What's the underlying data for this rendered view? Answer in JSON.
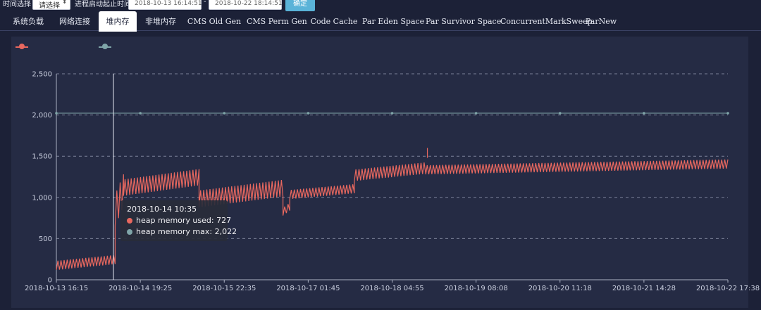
{
  "toolbar": {
    "time_select_label": "时间选择",
    "select_value": "请选择",
    "process_start_label": "进程启动起止时间",
    "start_date": "2018-10-13 16:14:51",
    "dash": "-",
    "end_date": "2018-10-22 18:14:51",
    "confirm_label": "确定"
  },
  "tabs": [
    {
      "label": "系统负载",
      "active": false
    },
    {
      "label": "网络连接",
      "active": false
    },
    {
      "label": "堆内存",
      "active": true
    },
    {
      "label": "非堆内存",
      "active": false
    },
    {
      "label": "CMS Old Gen",
      "active": false
    },
    {
      "label": "CMS Perm Gen",
      "active": false
    },
    {
      "label": "Code Cache",
      "active": false
    },
    {
      "label": "Par Eden Space",
      "active": false
    },
    {
      "label": "Par Survivor Space",
      "active": false
    },
    {
      "label": "ConcurrentMarkSweep",
      "active": false
    },
    {
      "label": "ParNew",
      "active": false
    }
  ],
  "colors": {
    "used": "#e8685f",
    "max": "#7fa5a8",
    "grid": "#7c8299",
    "axis": "#aab0c2"
  },
  "tooltip": {
    "time": "2018-10-14 10:35",
    "used_label": "heap memory used: 727",
    "max_label": "heap memory max: 2,022"
  },
  "chart_data": {
    "type": "line",
    "x_tick_labels": [
      "2018-10-13 16:15",
      "2018-10-14 19:25",
      "2018-10-15 22:35",
      "2018-10-17 01:45",
      "2018-10-18 04:55",
      "2018-10-19 08:08",
      "2018-10-20 11:18",
      "2018-10-21 14:28",
      "2018-10-22 17:38"
    ],
    "y_tick_labels": [
      "0",
      "500",
      "1,000",
      "1,500",
      "2,000",
      "2,500"
    ],
    "ylim": [
      0,
      2500
    ],
    "grid": true,
    "legend_position": "top-left",
    "series": [
      {
        "key": "used",
        "segments": [
          {
            "x0": 0.0,
            "x1": 0.7,
            "low": 120,
            "high": 320
          },
          {
            "x0": 0.7,
            "x1": 0.8,
            "low": 650,
            "high": 1350
          },
          {
            "x0": 0.8,
            "x1": 1.7,
            "low": 1020,
            "high": 1380
          },
          {
            "x0": 1.7,
            "x1": 2.7,
            "low": 880,
            "high": 1250
          },
          {
            "x0": 2.7,
            "x1": 2.78,
            "low": 780,
            "high": 950
          },
          {
            "x0": 2.78,
            "x1": 3.55,
            "low": 980,
            "high": 1180
          },
          {
            "x0": 3.55,
            "x1": 4.4,
            "low": 1200,
            "high": 1450
          },
          {
            "x0": 4.4,
            "x1": 8.0,
            "low": 1280,
            "high": 1480
          }
        ]
      },
      {
        "key": "max",
        "value": 2022,
        "marker_x": [
          0.0,
          1.0,
          2.0,
          3.0,
          4.0,
          5.0,
          6.0,
          7.0,
          8.0
        ]
      }
    ],
    "cursor_x": 0.68,
    "tooltip_values": {
      "used": 727,
      "max": 2022
    }
  }
}
